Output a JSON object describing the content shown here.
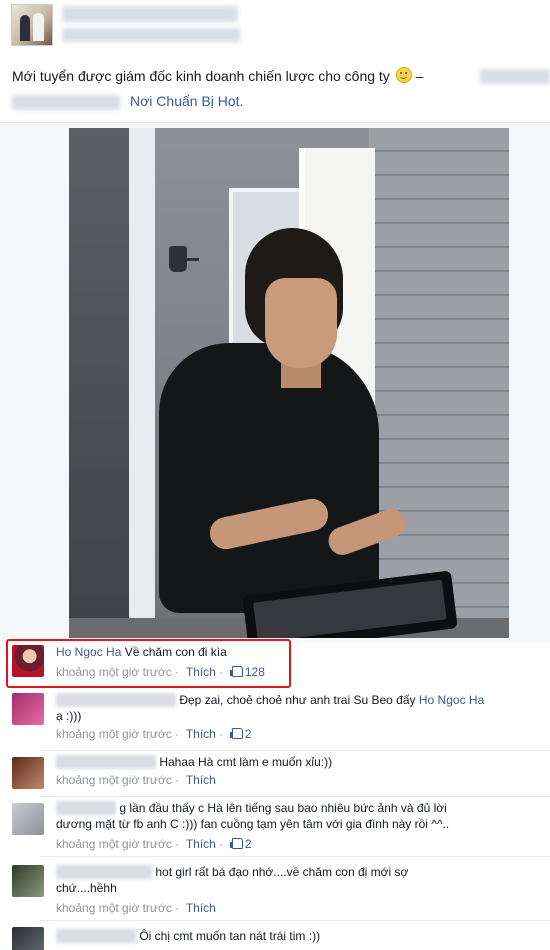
{
  "post": {
    "text_main": "Mới tuyển được giám đốc kinh doanh chiến lược cho công ty",
    "text_dash": "–",
    "page_link": "Nơi Chuẩn Bị Hot."
  },
  "comments": [
    {
      "name": "Ho Ngoc Ha",
      "text": "Về chăm con đi kìa",
      "time": "khoảng một giờ trước",
      "like_label": "Thích",
      "likes": "128"
    },
    {
      "text": "Đẹp zai, choẻ choẻ như anh trai Su Beo đấy",
      "mention": "Ho Ngoc Ha",
      "text_tail": "ạ :)))",
      "time": "khoảng một giờ trước",
      "like_label": "Thích",
      "likes": "2"
    },
    {
      "text": "Hahaa Hà cmt làm e muốn xỉu:))",
      "time": "khoảng một giờ trước",
      "like_label": "Thích"
    },
    {
      "text": "g lần đầu thấy c Hà lên tiếng sau bao nhiêu bức ảnh và đủ lời",
      "text2": "dương mặt từ fb anh C :))) fan cuồng tạm yên tâm với gia đình này rồi ^^..",
      "time": "khoảng một giờ trước",
      "like_label": "Thích",
      "likes": "2"
    },
    {
      "text": "hot girl rất bá đạo nhớ....về chăm con đị mới sợ",
      "text2": "chứ....hềhh",
      "time": "khoảng một giờ trước",
      "like_label": "Thích"
    },
    {
      "text": "Ôi chị cmt muốn tan nát trái tim :))"
    }
  ]
}
